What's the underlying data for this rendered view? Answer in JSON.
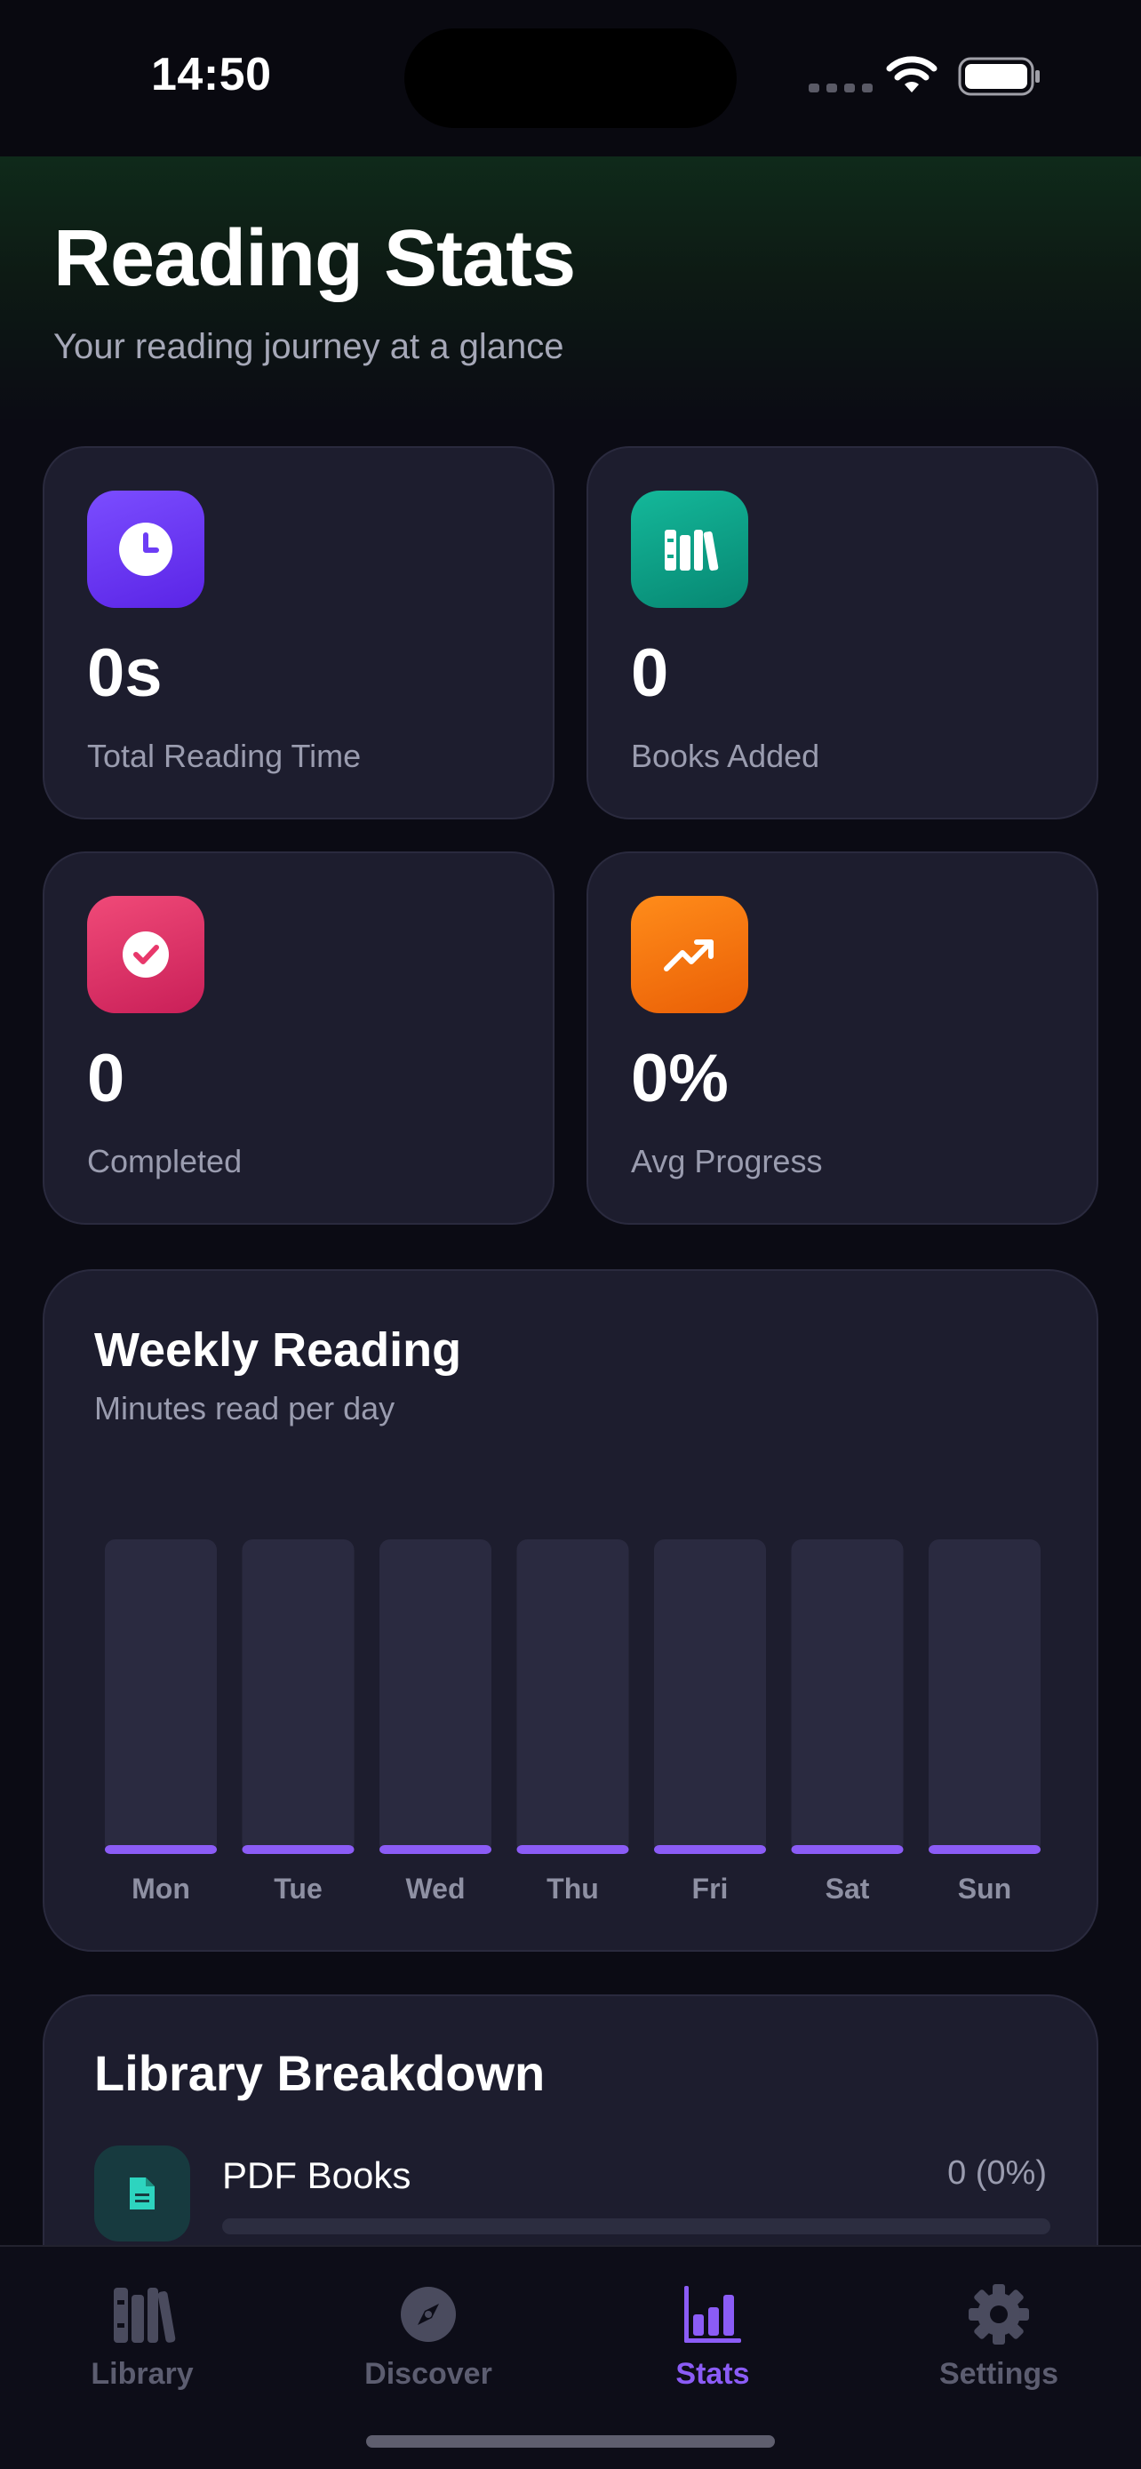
{
  "status_bar": {
    "time": "14:50"
  },
  "header": {
    "title": "Reading Stats",
    "subtitle": "Your reading journey at a glance"
  },
  "stats": [
    {
      "value": "0s",
      "label": "Total Reading Time",
      "icon": "clock-icon",
      "color": "#6d3df5"
    },
    {
      "value": "0",
      "label": "Books Added",
      "icon": "books-icon",
      "color": "#0fa88b"
    },
    {
      "value": "0",
      "label": "Completed",
      "icon": "check-circle-icon",
      "color": "#e8386b"
    },
    {
      "value": "0%",
      "label": "Avg Progress",
      "icon": "trending-up-icon",
      "color": "#f77b0f"
    }
  ],
  "weekly": {
    "title": "Weekly Reading",
    "subtitle": "Minutes read per day"
  },
  "chart_data": {
    "type": "bar",
    "categories": [
      "Mon",
      "Tue",
      "Wed",
      "Thu",
      "Fri",
      "Sat",
      "Sun"
    ],
    "values": [
      0,
      0,
      0,
      0,
      0,
      0,
      0
    ],
    "title": "Weekly Reading",
    "subtitle": "Minutes read per day",
    "xlabel": "",
    "ylabel": "",
    "bar_color": "#8b5cf6",
    "track_color": "#2a2a40",
    "grid": false
  },
  "library": {
    "title": "Library Breakdown",
    "items": [
      {
        "name": "PDF Books",
        "count": "0 (0%)",
        "fraction": 0,
        "icon": "document-icon",
        "color": "#2dd4bf"
      }
    ]
  },
  "tabs": [
    {
      "label": "Library",
      "icon": "library-icon",
      "active": false
    },
    {
      "label": "Discover",
      "icon": "compass-icon",
      "active": false
    },
    {
      "label": "Stats",
      "icon": "bar-chart-icon",
      "active": true
    },
    {
      "label": "Settings",
      "icon": "gear-icon",
      "active": false
    }
  ],
  "colors": {
    "accent": "#8b5cf6",
    "background": "#0b0b14",
    "card": "#1d1d2e"
  }
}
